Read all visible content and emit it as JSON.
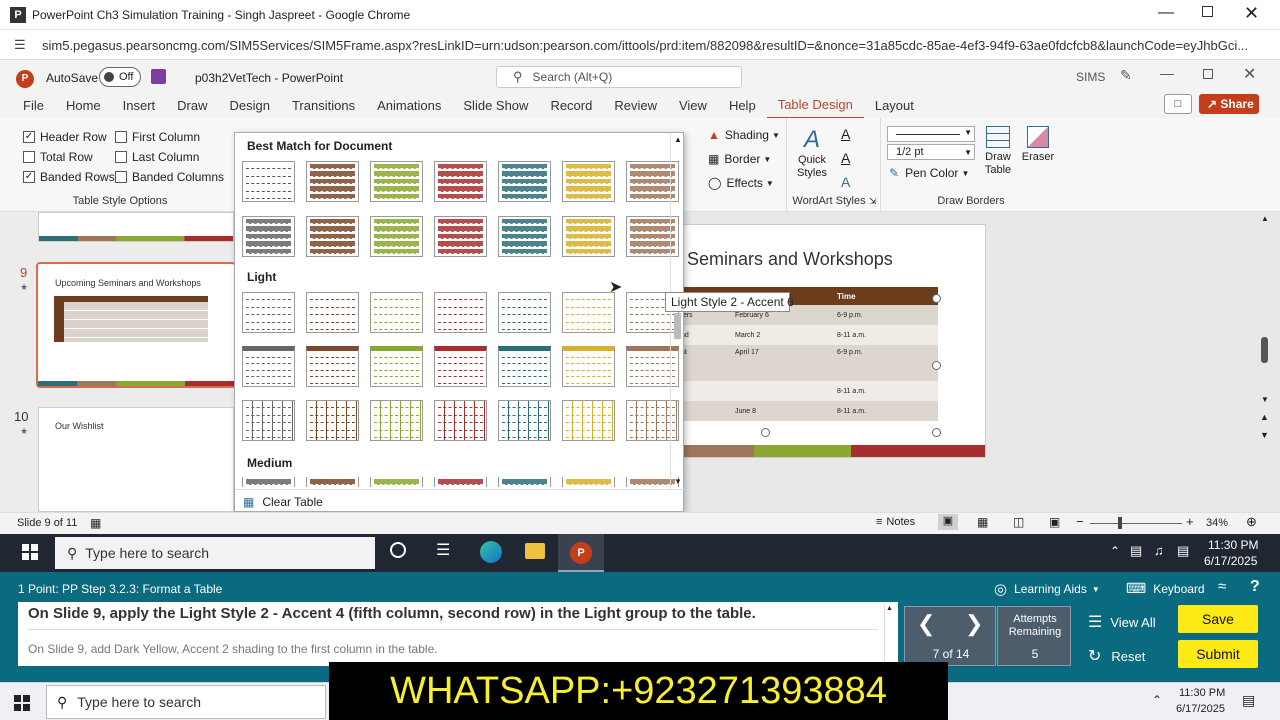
{
  "browser": {
    "title": "PowerPoint Ch3 Simulation Training - Singh Jaspreet - Google Chrome",
    "url": "sim5.pegasus.pearsoncmg.com/SIM5Services/SIM5Frame.aspx?resLinkID=urn:udson:pearson.com/ittools/prd:item/882098&resultID=&nonce=31a85cdc-85ae-4ef3-94f9-63ae0fdcfcb8&launchCode=eyJhbGci..."
  },
  "powerpoint": {
    "autosave_label": "AutoSave",
    "autosave_state": "Off",
    "file_name": "p03h2VetTech - PowerPoint",
    "search_placeholder": "Search (Alt+Q)",
    "user": "SIMS",
    "tabs": [
      "File",
      "Home",
      "Insert",
      "Draw",
      "Design",
      "Transitions",
      "Animations",
      "Slide Show",
      "Record",
      "Review",
      "View",
      "Help",
      "Table Design",
      "Layout"
    ],
    "share_label": "Share"
  },
  "ribbon": {
    "options": {
      "header_row": "Header Row",
      "total_row": "Total Row",
      "banded_rows": "Banded Rows",
      "first_column": "First Column",
      "last_column": "Last Column",
      "banded_columns": "Banded Columns",
      "group_label": "Table Style Options"
    },
    "shading": "Shading",
    "border": "Border",
    "effects": "Effects",
    "quick_styles": "Quick Styles",
    "wordart_label": "WordArt Styles",
    "pen_weight": "1/2 pt",
    "pen_color": "Pen Color",
    "draw_table": "Draw Table",
    "eraser": "Eraser",
    "draw_borders_label": "Draw Borders"
  },
  "gallery": {
    "best_match_label": "Best Match for Document",
    "light_label": "Light",
    "medium_label": "Medium",
    "clear_table": "Clear Table",
    "tooltip": "Light Style 2 - Accent 6",
    "colors": [
      "#666666",
      "#7a4a2a",
      "#8aa832",
      "#a82e2e",
      "#2e6e78",
      "#d8b02a",
      "#a0765a"
    ]
  },
  "slides": {
    "slide9_number": "9",
    "slide9_title": "Upcoming Seminars and Workshops",
    "slide10_number": "10",
    "slide10_title": "Our Wishlist"
  },
  "slide_canvas": {
    "title": "Seminars and Workshops",
    "headers": [
      "Date",
      "Time"
    ],
    "rows": [
      {
        "c0": "ters",
        "date": "February 6",
        "time": "6-9 p.m."
      },
      {
        "c0": "nd",
        "date": "March 2",
        "time": "8-11 a.m."
      },
      {
        "c0": "at",
        "date": "April 17",
        "time": "6-9 p.m."
      },
      {
        "c0": "",
        "date": "",
        "time": "8-11 a.m."
      },
      {
        "c0": "",
        "date": "June 8",
        "time": "8-11 a.m."
      }
    ]
  },
  "statusbar": {
    "slide_info": "Slide 9 of 11",
    "notes": "Notes",
    "zoom": "34%"
  },
  "vm_taskbar": {
    "search_placeholder": "Type here to search",
    "time": "11:30 PM",
    "date": "6/17/2025"
  },
  "sim": {
    "step": "1 Point: PP Step 3.2.3: Format a Table",
    "learning_aids": "Learning Aids",
    "keyboard": "Keyboard",
    "instruction_main": "On Slide 9, apply the Light Style 2 - Accent 4 (fifth column, second row) in the Light group to the table.",
    "instruction_next": "On Slide 9, add Dark Yellow, Accent 2 shading to the first column in the table.",
    "progress": "7 of 14",
    "attempts_label": "Attempts Remaining",
    "attempts": "5",
    "view_all": "View All",
    "reset": "Reset",
    "save": "Save",
    "submit": "Submit"
  },
  "overlay": {
    "text": "WHATSAPP:+923271393884"
  },
  "host_taskbar": {
    "search_placeholder": "Type here to search",
    "time": "11:30 PM",
    "date": "6/17/2025"
  }
}
